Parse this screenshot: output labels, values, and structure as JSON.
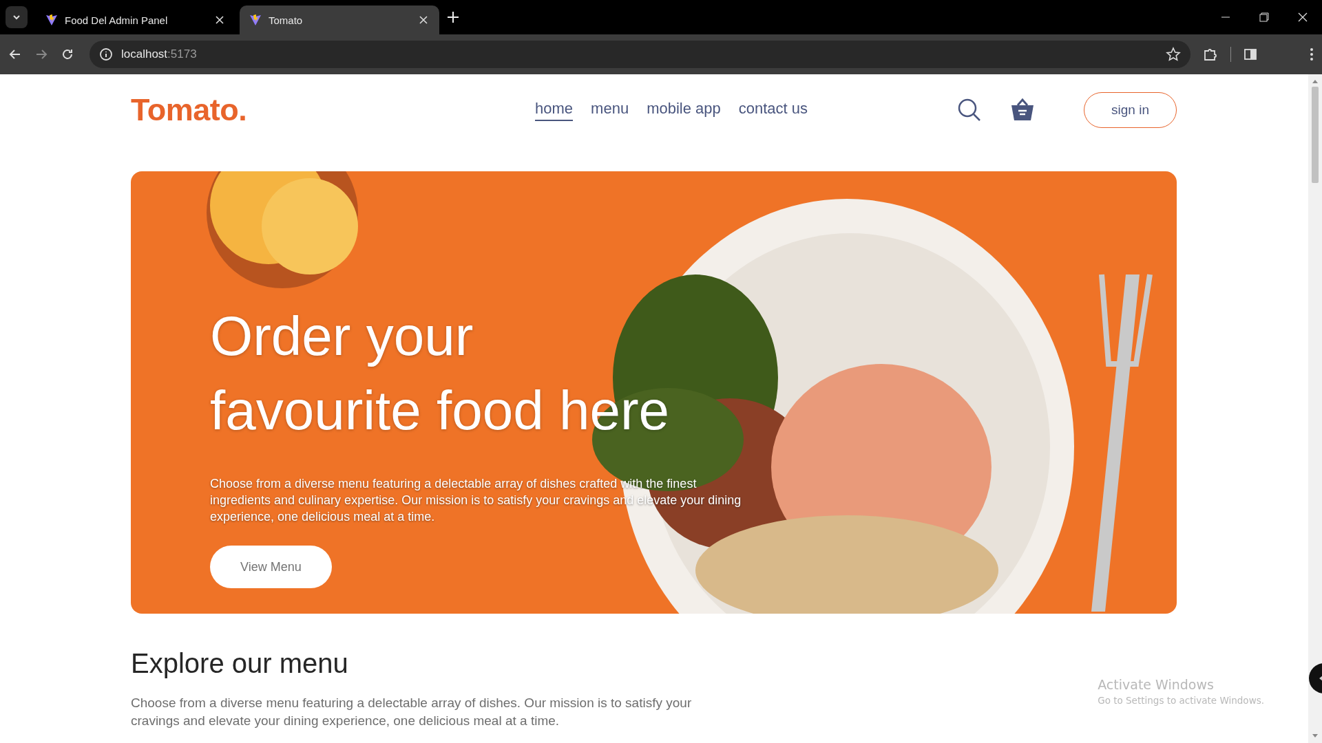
{
  "browser": {
    "tabs": [
      {
        "title": "Food Del Admin Panel",
        "selected": false
      },
      {
        "title": "Tomato",
        "selected": true
      }
    ],
    "address": {
      "host": "localhost",
      "port": ":5173"
    }
  },
  "header": {
    "logo": "Tomato.",
    "nav": [
      {
        "label": "home",
        "selected": true
      },
      {
        "label": "menu",
        "selected": false
      },
      {
        "label": "mobile app",
        "selected": false
      },
      {
        "label": "contact us",
        "selected": false
      }
    ],
    "sign_in": "sign in"
  },
  "hero": {
    "title_lines": [
      "Order your",
      "favourite food here"
    ],
    "text": "Choose from a diverse menu featuring a delectable array of dishes crafted with the finest ingredients and culinary expertise. Our mission is to satisfy your cravings and elevate your dining experience, one delicious meal at a time.",
    "button": "View Menu"
  },
  "explore": {
    "heading": "Explore our menu",
    "text": "Choose from a diverse menu featuring a delectable array of dishes. Our mission is to satisfy your cravings and elevate your dining experience, one delicious meal at a time."
  },
  "os_notice": {
    "title": "Activate Windows",
    "text": "Go to Settings to activate Windows."
  }
}
